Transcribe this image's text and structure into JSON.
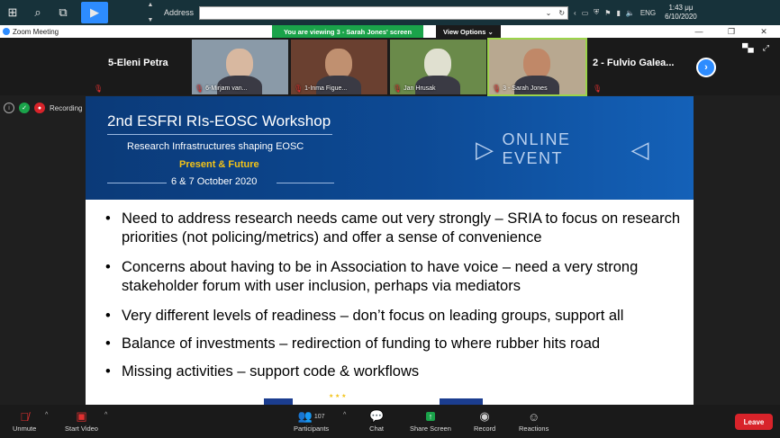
{
  "taskbar": {
    "address_label": "Address",
    "language": "ENG",
    "time": "1:43 μμ",
    "date": "6/10/2020"
  },
  "window": {
    "app_title": "Zoom Meeting",
    "viewing_banner": "You are viewing 3 - Sarah Jones' screen",
    "view_options": "View Options ⌄"
  },
  "gallery": {
    "left_name": "5-Eleni Petra",
    "right_name": "2 - Fulvio Galea...",
    "tiles": [
      {
        "label": "6-Mirjam van...",
        "bg": "#8a9aa8",
        "face": "#d8b8a0"
      },
      {
        "label": "1-Inma Figue...",
        "bg": "#6a4030",
        "face": "#c09070"
      },
      {
        "label": "Jan Hrusak",
        "bg": "#6a8a4a",
        "face": "#e0e0d0"
      },
      {
        "label": "3 - Sarah Jones",
        "bg": "#b8a890",
        "face": "#c08868"
      }
    ]
  },
  "recording": {
    "label": "Recording"
  },
  "slide": {
    "title": "2nd ESFRI RIs-EOSC Workshop",
    "subtitle": "Research Infrastructures shaping EOSC",
    "tagline": "Present & Future",
    "dates": "6 & 7 October 2020",
    "event": "ONLINE EVENT",
    "bullets": [
      "Need to address research needs came out very strongly – SRIA to focus on research priorities (not policing/metrics) and offer a sense of convenience",
      "Concerns about having to be in Association to have voice – need a very strong stakeholder forum with user inclusion, perhaps via mediators",
      "Very different levels of readiness – don’t focus on leading groups, support all",
      "Balance of investments – redirection of funding to where rubber hits road",
      "Missing activities – support code & workflows"
    ]
  },
  "toolbar": {
    "unmute": "Unmute",
    "start_video": "Start Video",
    "participants": "Participants",
    "participants_count": "107",
    "chat": "Chat",
    "share_screen": "Share Screen",
    "record": "Record",
    "reactions": "Reactions",
    "leave": "Leave"
  },
  "colors": {
    "accent": "#2d8cff",
    "share_green": "#1aa34a",
    "leave_red": "#d8232a",
    "slide_blue": "#0d4a95",
    "gold": "#f3c318"
  }
}
